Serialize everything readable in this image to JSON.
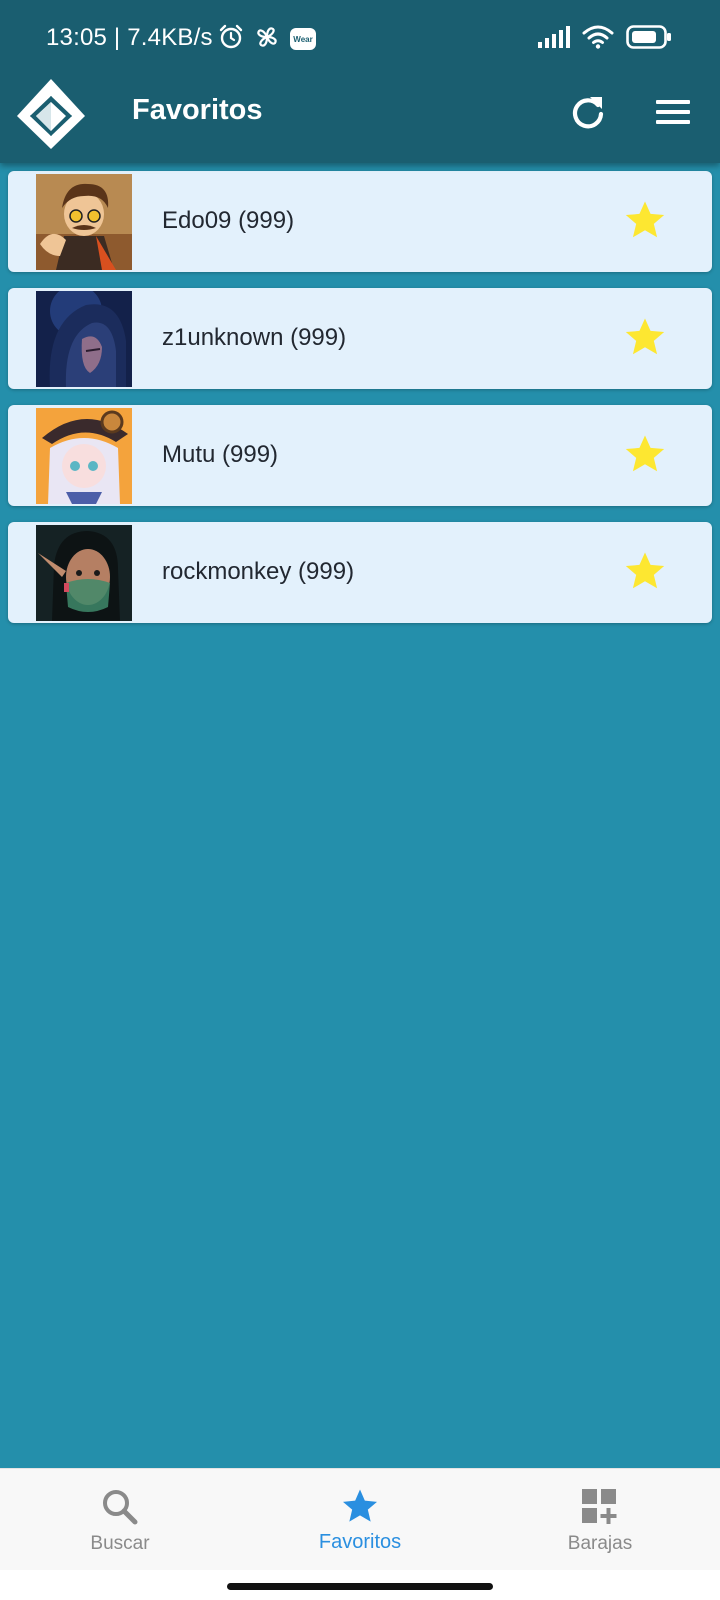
{
  "status_bar": {
    "time_speed": "13:05 | 7.4KB/s",
    "icons_left": [
      "alarm-icon",
      "pinwheel-icon",
      "wear-icon"
    ],
    "wear_badge": "Wear",
    "icons_right": [
      "signal-icon",
      "wifi-icon",
      "battery-icon"
    ]
  },
  "app_bar": {
    "title": "Favoritos",
    "logo": "diamond-logo",
    "actions": [
      "refresh-icon",
      "menu-icon"
    ]
  },
  "favorites": [
    {
      "name": "Edo09 (999)",
      "avatar": "avatar-edo09",
      "starred": true
    },
    {
      "name": "z1unknown (999)",
      "avatar": "avatar-z1unknown",
      "starred": true
    },
    {
      "name": "Mutu (999)",
      "avatar": "avatar-mutu",
      "starred": true
    },
    {
      "name": "rockmonkey (999)",
      "avatar": "avatar-rockmonkey",
      "starred": true
    }
  ],
  "bottom_nav": {
    "items": [
      {
        "label": "Buscar",
        "icon": "search-icon",
        "active": false
      },
      {
        "label": "Favoritos",
        "icon": "star-icon",
        "active": true
      },
      {
        "label": "Barajas",
        "icon": "add-deck-icon",
        "active": false
      }
    ]
  },
  "colors": {
    "app_bar": "#1a5e70",
    "background": "#248fab",
    "card": "#e3f1fc",
    "star": "#fde731",
    "nav_active": "#2a8fe0",
    "nav_inactive": "#8a8a8a"
  }
}
